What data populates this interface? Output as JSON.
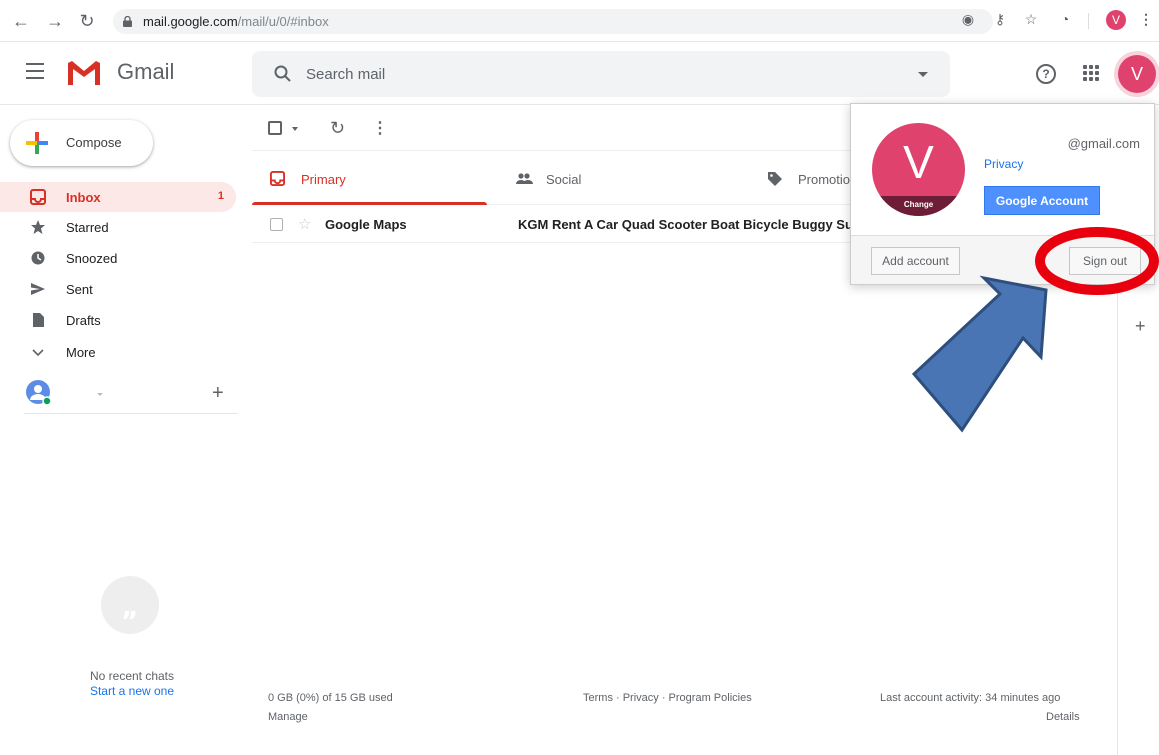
{
  "browser": {
    "url_host": "mail.google.com",
    "url_path": "/mail/u/0/#inbox",
    "profile_initial": "V"
  },
  "header": {
    "app_name": "Gmail",
    "search_placeholder": "Search mail",
    "help_icon": "?",
    "avatar_initial": "V"
  },
  "sidebar": {
    "compose_label": "Compose",
    "items": [
      {
        "label": "Inbox",
        "count": "1",
        "icon": "inbox-icon"
      },
      {
        "label": "Starred",
        "count": "",
        "icon": "star-icon"
      },
      {
        "label": "Snoozed",
        "count": "",
        "icon": "clock-icon"
      },
      {
        "label": "Sent",
        "count": "",
        "icon": "send-icon"
      },
      {
        "label": "Drafts",
        "count": "",
        "icon": "draft-icon"
      },
      {
        "label": "More",
        "count": "",
        "icon": "chevron-down-icon"
      }
    ],
    "no_chats": "No recent chats",
    "start_new": "Start a new one"
  },
  "tabs": [
    {
      "label": "Primary",
      "icon": "inbox-icon"
    },
    {
      "label": "Social",
      "icon": "people-icon"
    },
    {
      "label": "Promotio",
      "icon": "tag-icon"
    }
  ],
  "emails": [
    {
      "sender": "Google Maps",
      "subject": "KGM Rent A Car Quad Scooter Boat Bicycle Buggy Su"
    }
  ],
  "footer": {
    "storage": "0 GB (0%) of 15 GB used",
    "manage": "Manage",
    "links": "Terms · Privacy · Program Policies",
    "activity": "Last account activity: 34 minutes ago",
    "details": "Details"
  },
  "account_popup": {
    "avatar_initial": "V",
    "change_label": "Change",
    "email": "@gmail.com",
    "privacy": "Privacy",
    "google_account": "Google Account",
    "add_account": "Add account",
    "sign_out": "Sign out"
  },
  "colors": {
    "accent_red": "#d93025",
    "avatar_pink": "#e0426e",
    "annotation_red": "#e8000f",
    "annotation_arrow": "#4a75b5"
  }
}
